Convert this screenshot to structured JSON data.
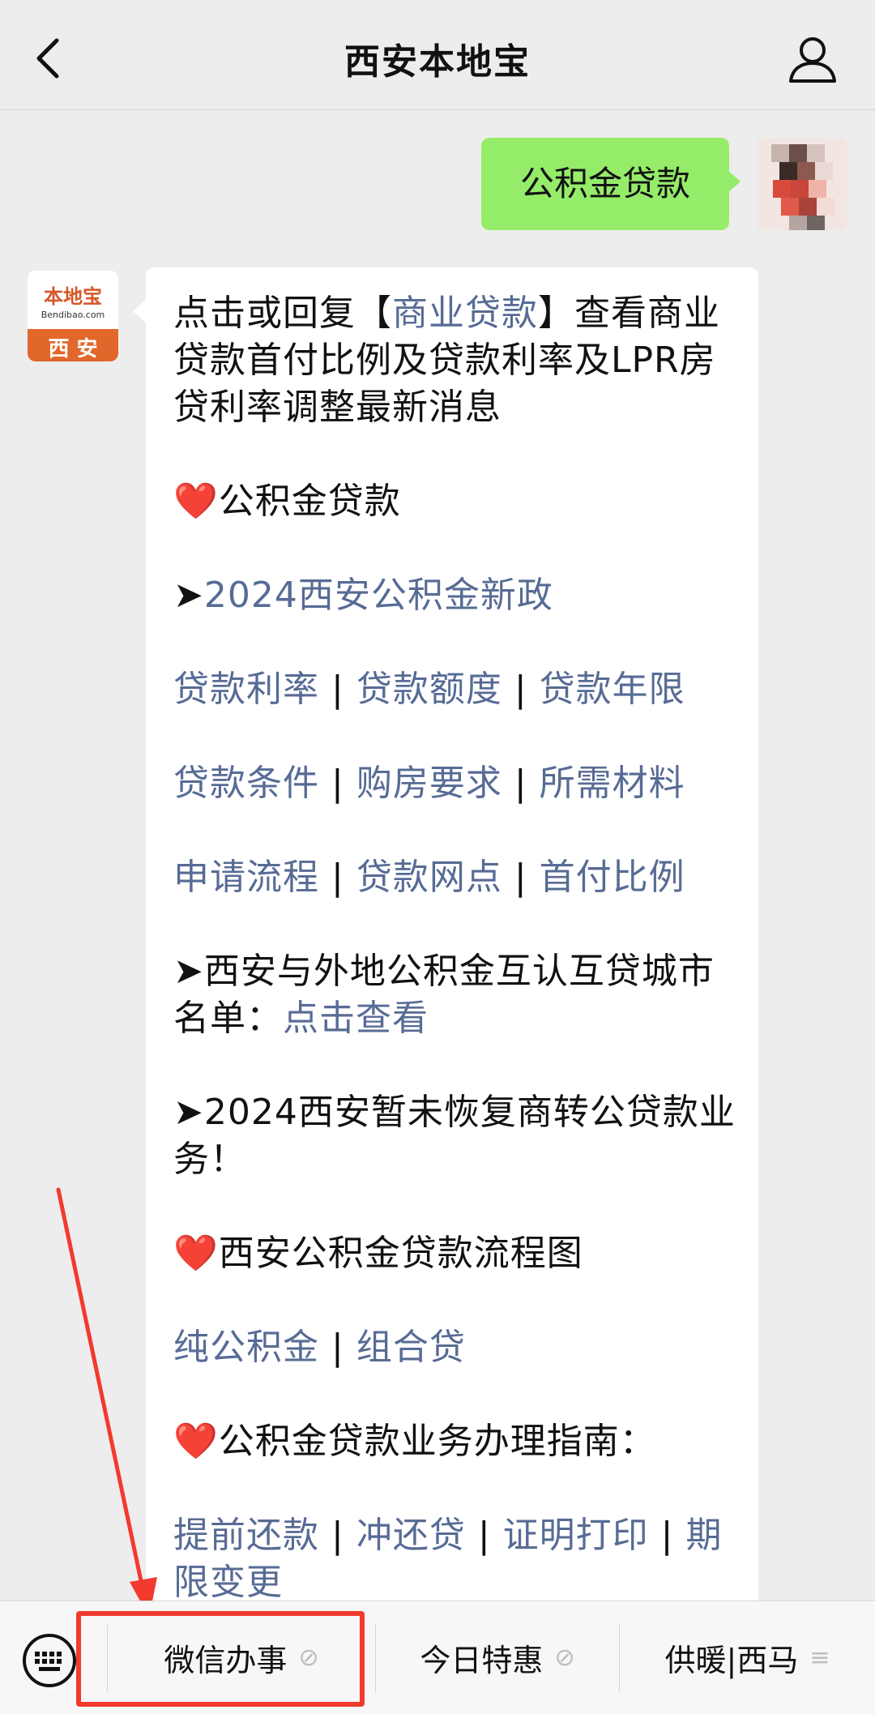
{
  "nav": {
    "title": "西安本地宝",
    "back_icon": "back-chevron-icon",
    "profile_icon": "person-icon"
  },
  "outgoing": {
    "text": "公积金贷款",
    "bubble_color": "#95ec69"
  },
  "incoming": {
    "avatar": {
      "logo_text": "本地宝",
      "logo_domain": "Bendibao.com",
      "logo_city": "西 安",
      "brand_color": "#e2672a"
    },
    "intro_prefix": "点击或回复【",
    "intro_link": "商业贷款",
    "intro_suffix": "】查看商业贷款首付比例及贷款利率及LPR房贷利率调整最新消息",
    "section1_title": "公积金贷款",
    "policy_link": "2024西安公积金新政",
    "link_rows": [
      [
        "贷款利率",
        "贷款额度",
        "贷款年限"
      ],
      [
        "贷款条件",
        "购房要求",
        "所需材料"
      ],
      [
        "申请流程",
        "贷款网点",
        "首付比例"
      ]
    ],
    "mutual_text": "西安与外地公积金互认互贷城市名单：",
    "mutual_link": "点击查看",
    "commercial_text": "2024西安暂未恢复商转公贷款业务！",
    "section2_title": "西安公积金贷款流程图",
    "flow_links": [
      "纯公积金",
      "组合贷"
    ],
    "section3_title": "公积金贷款业务办理指南：",
    "guide_links": [
      "提前还款",
      "冲还贷",
      "证明打印",
      "期限变更"
    ],
    "link_color": "#576b95",
    "arrow_glyph": "➤",
    "heart_glyph": "❤️",
    "separator": "|"
  },
  "bottom_menu": {
    "keyboard_icon": "keyboard-icon",
    "items": [
      {
        "label": "微信办事",
        "icon": "link-icon",
        "icon_glyph": "⊘"
      },
      {
        "label": "今日特惠",
        "icon": "link-icon",
        "icon_glyph": "⊘"
      },
      {
        "label": "供暖|西马",
        "icon": "menu-icon",
        "icon_glyph": "≡"
      }
    ],
    "highlight_color": "#f23a2e"
  }
}
